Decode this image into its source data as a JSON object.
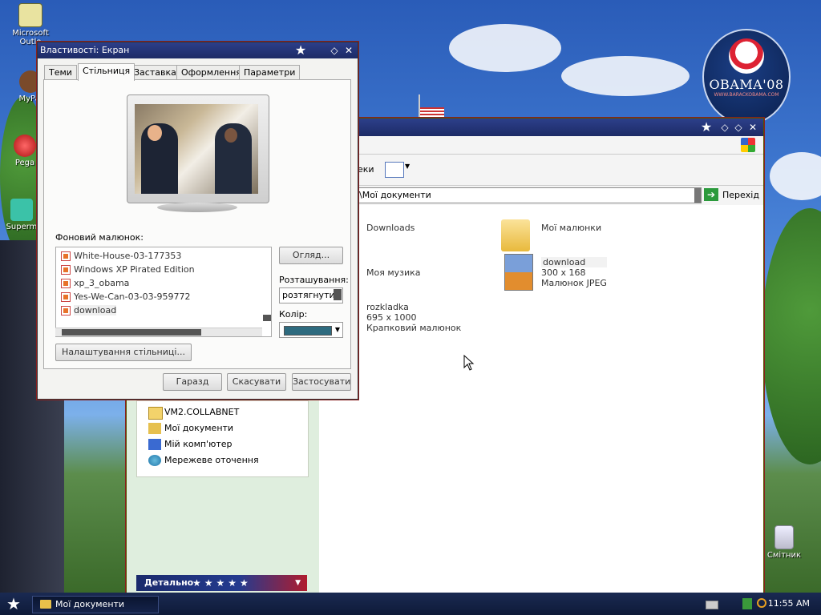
{
  "desktop": {
    "icons": [
      {
        "name": "outlook",
        "label": "Microsoft Outlo"
      },
      {
        "name": "mypal",
        "label": "MyPal"
      },
      {
        "name": "pegas",
        "label": "Pega"
      },
      {
        "name": "superm",
        "label": "Superm"
      }
    ],
    "obama_badge": {
      "main": "OBAMA'08",
      "sub": "WWW.BARACKOBAMA.COM"
    },
    "recycle_bin": "Смітник"
  },
  "explorer": {
    "toolbar_partial_label": "еки",
    "address_value": "\\Мої документи",
    "go_button": "Перехід",
    "items": [
      {
        "name": "downloads",
        "line1": "Downloads",
        "line2": "",
        "line3": ""
      },
      {
        "name": "my-pictures",
        "line1": "Мої малюнки",
        "line2": "",
        "line3": ""
      },
      {
        "name": "my-music",
        "line1": "Моя музика",
        "line2": "",
        "line3": ""
      },
      {
        "name": "download-jpeg",
        "line1": "download",
        "line2": "300 x 168",
        "line3": "Малюнок JPEG"
      },
      {
        "name": "rozkladka",
        "line1": "rozkladka",
        "line2": "695 x 1000",
        "line3": "Крапковий малюнок"
      }
    ],
    "other_places": [
      {
        "name": "vm2",
        "label": "VM2.COLLABNET"
      },
      {
        "name": "my-documents",
        "label": "Мої документи"
      },
      {
        "name": "my-computer",
        "label": "Мій комп'ютер"
      },
      {
        "name": "network",
        "label": "Мережеве оточення"
      }
    ],
    "details_label": "Детально"
  },
  "dialog": {
    "title": "Властивості: Екран",
    "tabs": [
      "Теми",
      "Стільниця",
      "Заставка",
      "Оформлення",
      "Параметри"
    ],
    "active_tab": "Стільниця",
    "background_label": "Фоновий малюнок:",
    "backgrounds": [
      "White-House-03-177353",
      "Windows XP Pirated Edition",
      "xp_3_obama",
      "Yes-We-Can-03-03-959772",
      "download"
    ],
    "selected_background": "download",
    "browse_button": "Огляд...",
    "position_label": "Розташування:",
    "position_value": "розтягнути",
    "color_label": "Колір:",
    "color_value": "#2e6b7f",
    "customize_button": "Налаштування стільниці...",
    "ok_button": "Гаразд",
    "cancel_button": "Скасувати",
    "apply_button": "Застосувати"
  },
  "taskbar": {
    "task_label": "Мої документи",
    "clock": "11:55 AM"
  },
  "colors": {
    "titlebar": "#1d2b66",
    "accent_red": "#8a1f1f",
    "taskbar": "#0e1a38"
  }
}
